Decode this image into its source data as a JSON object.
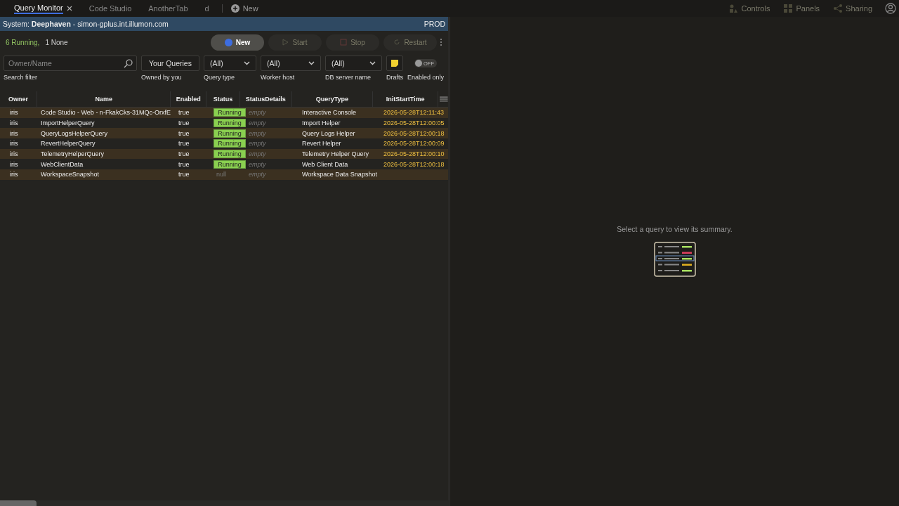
{
  "tabs": [
    {
      "label": "Query Monitor",
      "selected": true,
      "closable": true
    },
    {
      "label": "Code Studio",
      "selected": false,
      "closable": false
    },
    {
      "label": "AnotherTab",
      "selected": false,
      "closable": false
    },
    {
      "label": "d",
      "selected": false,
      "closable": false
    }
  ],
  "new_tab": "New",
  "top_menu": [
    {
      "label": "Controls",
      "kind": "controls"
    },
    {
      "label": "Panels",
      "kind": "panels"
    },
    {
      "label": "Sharing",
      "kind": "sharing"
    }
  ],
  "system_bar": {
    "prefix": "System: **Deephaven** - simon-gplus.int.illumon.com",
    "env": "PROD"
  },
  "summary": {
    "running": "6 Running,",
    "none": "1 None"
  },
  "actions": [
    {
      "label": "New",
      "disabled": false,
      "kind": "new"
    },
    {
      "label": "Start",
      "disabled": true,
      "kind": "start"
    },
    {
      "label": "Stop",
      "disabled": true,
      "kind": "stop"
    },
    {
      "label": "Restart",
      "disabled": true,
      "kind": "restart"
    }
  ],
  "filters": {
    "search": {
      "placeholder": "Owner/Name",
      "label": "Search filter"
    },
    "owned": {
      "value": "Your Queries",
      "label": "Owned by you"
    },
    "selects": [
      {
        "value": "(All)",
        "label": "Query type"
      },
      {
        "value": "(All)",
        "label": "Worker host"
      },
      {
        "value": "(All)",
        "label": "DB server name"
      }
    ],
    "drafts": {
      "label": "Drafts"
    },
    "enabled_only": {
      "label": "Enabled only",
      "on": false,
      "text": "OFF"
    }
  },
  "table": {
    "columns": [
      "Owner",
      "Name",
      "Enabled",
      "Status",
      "StatusDetails",
      "QueryType",
      "InitStartTime"
    ],
    "rows": [
      {
        "owner": "iris",
        "name": "Code Studio - Web - n-FkakCks-31MQc-OrxfE",
        "enabled": "true",
        "status": "Running",
        "running": true,
        "details": "empty",
        "type": "Interactive Console",
        "time": "2026-05-28T12:11:43"
      },
      {
        "owner": "iris",
        "name": "ImportHelperQuery",
        "enabled": "true",
        "status": "Running",
        "running": true,
        "details": "empty",
        "type": "Import Helper",
        "time": "2026-05-28T12:00:05"
      },
      {
        "owner": "iris",
        "name": "QueryLogsHelperQuery",
        "enabled": "true",
        "status": "Running",
        "running": true,
        "details": "empty",
        "type": "Query Logs Helper",
        "time": "2026-05-28T12:00:18"
      },
      {
        "owner": "iris",
        "name": "RevertHelperQuery",
        "enabled": "true",
        "status": "Running",
        "running": true,
        "details": "empty",
        "type": "Revert Helper",
        "time": "2026-05-28T12:00:09"
      },
      {
        "owner": "iris",
        "name": "TelemetryHelperQuery",
        "enabled": "true",
        "status": "Running",
        "running": true,
        "details": "empty",
        "type": "Telemetry Helper Query",
        "time": "2026-05-28T12:00:10"
      },
      {
        "owner": "iris",
        "name": "WebClientData",
        "enabled": "true",
        "status": "Running",
        "running": true,
        "details": "empty",
        "type": "Web Client Data",
        "time": "2026-05-28T12:00:18"
      },
      {
        "owner": "iris",
        "name": "WorkspaceSnapshot",
        "enabled": "true",
        "status": "null",
        "running": false,
        "details": "empty",
        "type": "Workspace Data Snapshot",
        "time": ""
      }
    ]
  },
  "empty_state": "Select a query to view its summary."
}
